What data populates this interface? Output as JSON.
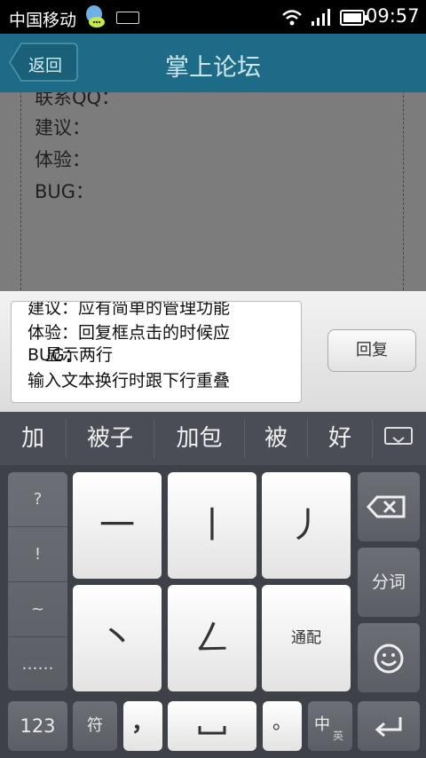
{
  "status_bar": {
    "carrier": "中国移动",
    "time": "09:57",
    "icons": [
      "qq-icon",
      "keyboard-icon",
      "wifi-icon",
      "signal-icon",
      "battery-icon"
    ]
  },
  "header": {
    "back_label": "返回",
    "title": "掌上论坛"
  },
  "form": {
    "lines": [
      "联系QQ：",
      "建议：",
      "体验：",
      "BUG："
    ]
  },
  "reply": {
    "lines": [
      "建议：应有简单的管理功能",
      "体验：回复框点击的时候应",
      "显示两行",
      "BUG：",
      "输入文本换行时跟下行重叠"
    ],
    "button_label": "回复"
  },
  "candidates": [
    "加",
    "被子",
    "加包",
    "被",
    "好"
  ],
  "keyboard": {
    "symbols": [
      "?",
      "!",
      "~",
      "……"
    ],
    "strokes": [
      "一",
      "丨",
      "丿",
      "丶",
      "ㄥ"
    ],
    "wildcard": "通配",
    "segment": "分词",
    "num_key": "123",
    "symbol_key": "符",
    "comma": "，",
    "period": "。",
    "lang_main": "中",
    "lang_sub": "英"
  },
  "colors": {
    "titlebar": "#1d6b86",
    "keyboard_bg": "#3f4148",
    "candidate_bg": "#4a4d55"
  }
}
